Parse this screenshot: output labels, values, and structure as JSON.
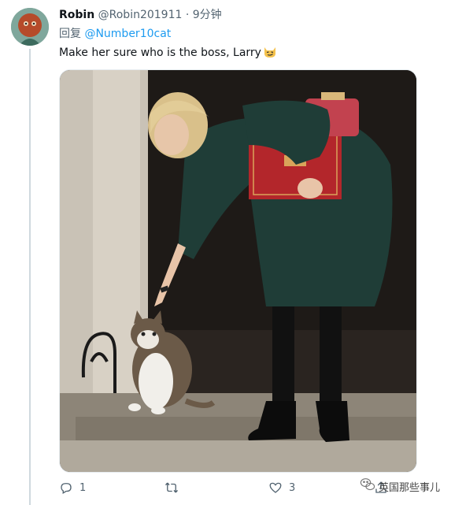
{
  "tweet": {
    "author_name": "Robin",
    "author_handle": "@Robin201911",
    "separator": "·",
    "time": "9分钟",
    "reply_prefix": "回复",
    "reply_to": "@Number10cat",
    "text": "Make her sure who is the boss, Larry",
    "emoji": "smirking-cat-emoji"
  },
  "actions": {
    "reply_count": "1",
    "retweet_count": "",
    "like_count": "3"
  },
  "watermark": {
    "text": "英国那些事儿"
  },
  "icons": {
    "reply": "reply-icon",
    "retweet": "retweet-icon",
    "like": "heart-icon",
    "share": "share-icon",
    "watermark": "wechat-icon"
  },
  "colors": {
    "link": "#1d9bf0",
    "muted": "#536471",
    "text": "#0f1419"
  }
}
